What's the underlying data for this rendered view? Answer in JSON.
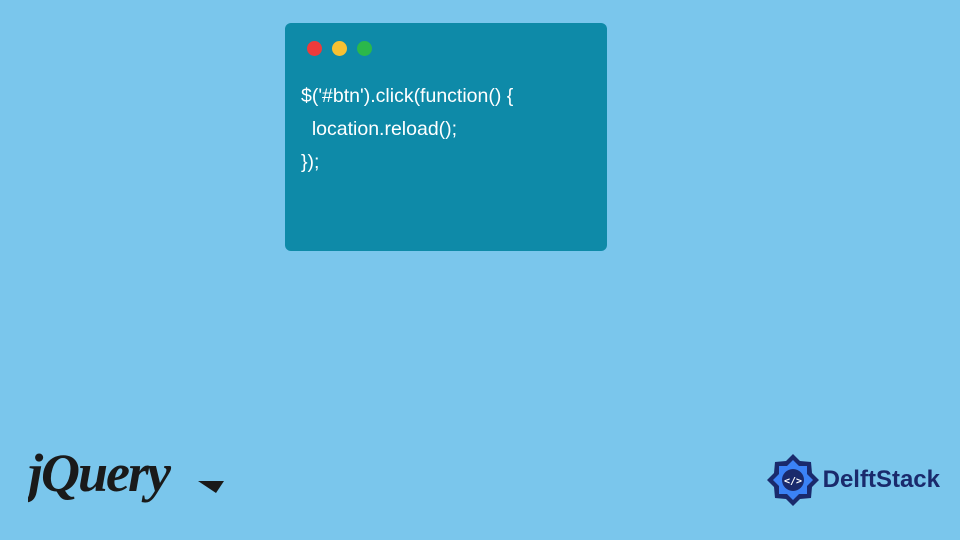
{
  "code_window": {
    "traffic_lights": {
      "red": "#ed3b3b",
      "yellow": "#f7c132",
      "green": "#2bb84a"
    },
    "background": "#0e8aa8",
    "code_lines": [
      "$('#btn').click(function() {",
      "  location.reload();",
      "});"
    ]
  },
  "jquery": {
    "label": "jQuery"
  },
  "delftstack": {
    "label": "DelftStack",
    "icon_color": "#1a2a6c",
    "icon_accent": "#3b82f6"
  },
  "page": {
    "background": "#7ac6ec"
  }
}
